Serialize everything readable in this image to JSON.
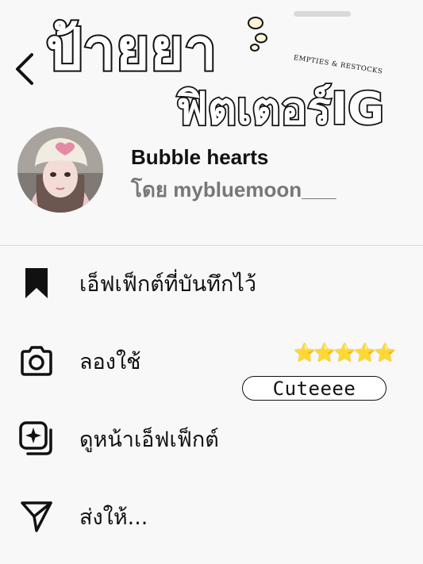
{
  "overlay": {
    "title_main": "ป้ายยา",
    "title_sub": "ฟิตเตอร์IG",
    "tagline": "EMPTIES & RESTOCKS",
    "rating": "⭐⭐⭐⭐⭐",
    "tag": "Cuteeee"
  },
  "effect": {
    "name": "Bubble hearts",
    "author_line": "โดย mybluemoon___"
  },
  "menu": {
    "items": [
      {
        "label": "เอ็ฟเฟ็กต์ที่บันทึกไว้",
        "icon": "bookmark-icon"
      },
      {
        "label": "ลองใช้",
        "icon": "camera-icon"
      },
      {
        "label": "ดูหน้าเอ็ฟเฟ็กต์",
        "icon": "effect-page-icon"
      },
      {
        "label": "ส่งให้...",
        "icon": "send-icon"
      }
    ]
  },
  "colors": {
    "background": "#f8f8f8",
    "text": "#111111",
    "secondary_text": "#777777",
    "star": "#f3cf2a"
  }
}
